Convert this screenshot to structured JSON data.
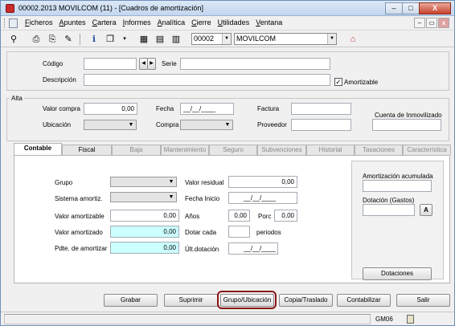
{
  "window": {
    "title": "00002.2013 MOVILCOM (11) - [Cuadros de amortización]",
    "minimize": "–",
    "maximize": "□",
    "close": "X"
  },
  "menu": [
    "Ficheros",
    "Apuntes",
    "Cartera",
    "Informes",
    "Analítica",
    "Cierre",
    "Utilidades",
    "Ventana"
  ],
  "mdi": {
    "minimize": "–",
    "restore": "▭",
    "close": "x"
  },
  "toolbar": {
    "company_code": "00002",
    "company_name": "MOVILCOM"
  },
  "header": {
    "codigo_label": "Código",
    "codigo_value": "",
    "serie_label": "Serie",
    "serie_value": "",
    "descripcion_label": "Descripción",
    "descripcion_value": "",
    "amortizable_label": "Amortizable",
    "amortizable_checked": "✓",
    "nav_prev": "◀",
    "nav_next": "▶"
  },
  "alta": {
    "title": "Alta",
    "valor_compra_label": "Valor compra",
    "valor_compra_value": "0,00",
    "fecha_label": "Fecha",
    "fecha_value": "__/__/____",
    "factura_label": "Factura",
    "factura_value": "",
    "cuenta_label": "Cuenta de Inmovilizado",
    "cuenta_value": "",
    "ubicacion_label": "Ubicación",
    "compra_label": "Compra",
    "proveedor_label": "Proveedor",
    "proveedor_value": ""
  },
  "tabs": [
    "Contable",
    "Fiscal",
    "Baja",
    "Mantenimiento",
    "Seguro",
    "Subvenciones",
    "Historial",
    "Tasaciones",
    "Característica"
  ],
  "contable": {
    "grupo_label": "Grupo",
    "sistema_label": "Sistema amortiz.",
    "valor_amortizable_label": "Valor amortizable",
    "valor_amortizable_value": "0,00",
    "valor_amortizado_label": "Valor amortizado",
    "valor_amortizado_value": "0,00",
    "pdte_label": "Pdte. de amortizar",
    "pdte_value": "0,00",
    "valor_residual_label": "Valor residual",
    "valor_residual_value": "0,00",
    "fecha_inicio_label": "Fecha Inicio",
    "fecha_inicio_value": "__/__/____",
    "anos_label": "Años",
    "anos_value": "0,00",
    "porc_label": "Porc",
    "porc_value": "0,00",
    "dotar_label": "Dotar cada",
    "dotar_value": "",
    "periodos_label": "periodos",
    "ult_dotacion_label": "Últ.dotación",
    "ult_dotacion_value": "__/__/____",
    "amort_acumulada_label": "Amortización acumulada",
    "amort_acumulada_value": "",
    "dotacion_gastos_label": "Dotación (Gastos)",
    "dotacion_gastos_value": "",
    "a_button": "A",
    "dotaciones_button": "Dotaciones"
  },
  "buttons": {
    "grabar": "Grabar",
    "suprimir": "Suprimir",
    "grupo_ubicacion": "Grupo/Ubicación",
    "copia_traslado": "Copia/Traslado",
    "contabilizar": "Contabilizar",
    "salir": "Salir"
  },
  "status": {
    "code": "GM06"
  }
}
